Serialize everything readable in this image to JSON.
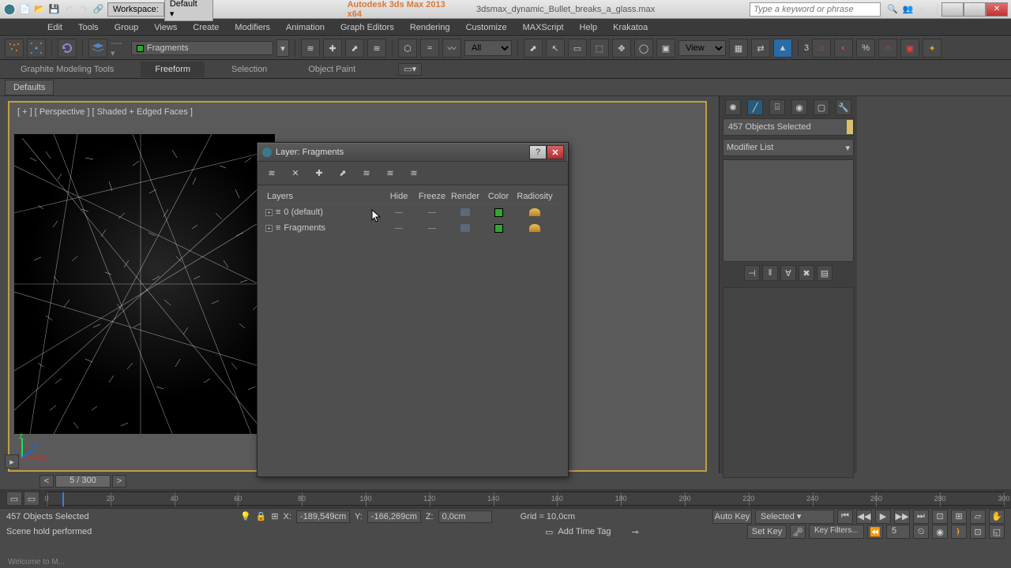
{
  "titlebar": {
    "app": "Autodesk 3ds Max 2013 x64",
    "file": "3dsmax_dynamic_Bullet_breaks_a_glass.max",
    "search_placeholder": "Type a keyword or phrase",
    "workspace_label": "Workspace:",
    "workspace_value": "Default"
  },
  "menu": [
    "Edit",
    "Tools",
    "Group",
    "Views",
    "Create",
    "Modifiers",
    "Animation",
    "Graph Editors",
    "Rendering",
    "Customize",
    "MAXScript",
    "Help",
    "Krakatoa"
  ],
  "toolbar": {
    "layer_name": "Fragments",
    "filter_value": "All",
    "views_value": "View",
    "spinner": "3"
  },
  "tabs": [
    "Graphite Modeling Tools",
    "Freeform",
    "Selection",
    "Object Paint"
  ],
  "active_tab": "Freeform",
  "defaults_btn": "Defaults",
  "viewport": {
    "label": "[ + ] [ Perspective ] [ Shaded + Edged Faces ]"
  },
  "side_panel": {
    "selection_text": "457 Objects Selected",
    "modifier_label": "Modifier List"
  },
  "dialog": {
    "title": "Layer: Fragments",
    "headers": {
      "layers": "Layers",
      "hide": "Hide",
      "freeze": "Freeze",
      "render": "Render",
      "color": "Color",
      "radiosity": "Radiosity"
    },
    "rows": [
      {
        "name": "0 (default)"
      },
      {
        "name": "Fragments"
      }
    ]
  },
  "timeslider": {
    "value": "5 / 300"
  },
  "timeline": {
    "ticks": [
      0,
      20,
      40,
      60,
      80,
      100,
      120,
      140,
      160,
      180,
      200,
      220,
      240,
      260,
      280,
      300
    ],
    "current": 5,
    "max": 300
  },
  "status": {
    "line1_left": "457 Objects Selected",
    "x": "-189,549cm",
    "xlabel": "X:",
    "y": "-166,269cm",
    "ylabel": "Y:",
    "z": "0,0cm",
    "zlabel": "Z:",
    "grid": "Grid = 10,0cm",
    "line2_left": "Scene hold performed",
    "addtag": "Add Time Tag",
    "autokey": "Auto Key",
    "setkey": "Set Key",
    "selected": "Selected",
    "keyfilters": "Key Filters...",
    "frame": "5"
  },
  "welcome": "Welcome to M..."
}
